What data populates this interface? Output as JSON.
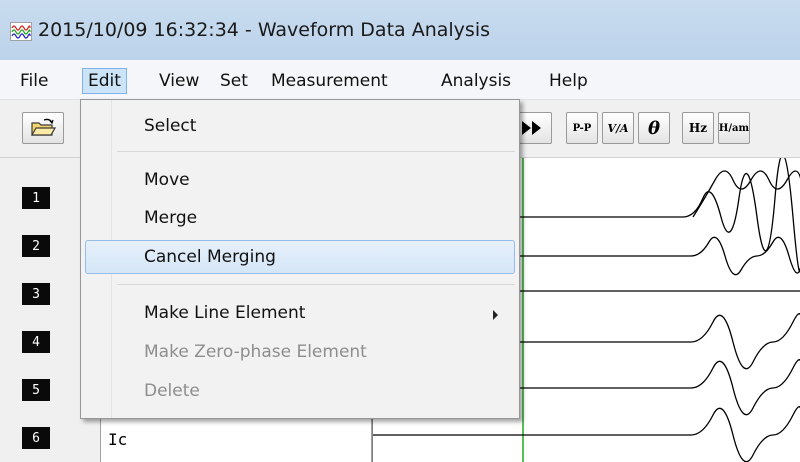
{
  "window": {
    "title": "2015/10/09 16:32:34  - Waveform Data Analysis",
    "icon": "waveform-app-icon"
  },
  "menubar": {
    "items": [
      "File",
      "Edit",
      "View",
      "Set",
      "Measurement",
      "Analysis",
      "Help"
    ],
    "active": "Edit"
  },
  "toolbar": {
    "buttons": [
      {
        "name": "open-folder-icon"
      },
      {
        "name": "fast-forward-icon"
      },
      {
        "label": "P-P",
        "name": "peak-to-peak-icon"
      },
      {
        "label": "V/A",
        "name": "volt-amp-icon"
      },
      {
        "label": "θ",
        "name": "theta-icon"
      },
      {
        "label": "Hz",
        "name": "hertz-icon"
      },
      {
        "label": "H/am",
        "name": "harmonics-icon"
      }
    ]
  },
  "channels": {
    "numbers": [
      "1",
      "2",
      "3",
      "4",
      "5",
      "6"
    ],
    "visible_label": "Ic"
  },
  "edit_menu": {
    "items": [
      {
        "label": "Select",
        "enabled": true
      },
      {
        "label": "Move",
        "enabled": true
      },
      {
        "label": "Merge",
        "enabled": true
      },
      {
        "label": "Cancel Merging",
        "enabled": true,
        "highlighted": true
      },
      {
        "label": "Make Line Element",
        "enabled": true,
        "submenu": true
      },
      {
        "label": "Make Zero-phase Element",
        "enabled": false
      },
      {
        "label": "Delete",
        "enabled": false
      }
    ]
  },
  "colors": {
    "menu_highlight": "#dceaf8",
    "cursor_line": "#22aa22",
    "disabled_text": "#8d8d8d"
  }
}
